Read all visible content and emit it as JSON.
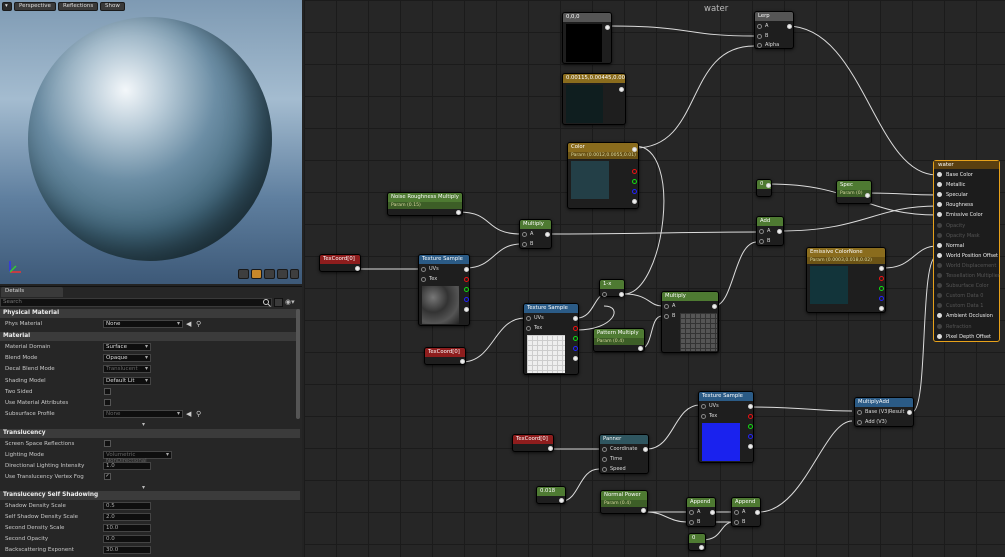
{
  "viewport": {
    "mode_label": "Perspective",
    "view_label": "Reflections",
    "show_label": "Show"
  },
  "details": {
    "tab": "Details",
    "search_placeholder": "Search"
  },
  "sections": {
    "physical": {
      "title": "Physical Material",
      "phys_label": "Phys Material",
      "phys_value": "None"
    },
    "material": {
      "title": "Material",
      "domain_label": "Material Domain",
      "domain_value": "Surface",
      "blend_label": "Blend Mode",
      "blend_value": "Opaque",
      "decal_label": "Decal Blend Mode",
      "decal_value": "Translucent",
      "shading_label": "Shading Model",
      "shading_value": "Default Lit",
      "two_sided_label": "Two Sided",
      "attrs_label": "Use Material Attributes",
      "subsurface_label": "Subsurface Profile",
      "subsurface_value": "None"
    },
    "translucency": {
      "title": "Translucency",
      "ssr_label": "Screen Space Reflections",
      "lighting_label": "Lighting Mode",
      "lighting_value": "Volumetric NonDirectional",
      "dir_label": "Directional Lighting Intensity",
      "dir_value": "1.0",
      "fog_label": "Use Translucency Vertex Fog"
    },
    "selfshadow": {
      "title": "Translucency Self Shadowing",
      "sds_label": "Shadow Density Scale",
      "sds_value": "0.5",
      "ssds_label": "Self Shadow Density Scale",
      "ssds_value": "2.0",
      "sec_label": "Second Density Scale",
      "sec_value": "10.0",
      "opac_label": "Second Opacity",
      "opac_value": "0.0",
      "back_label": "Backscattering Exponent",
      "back_value": "30.0"
    }
  },
  "graph": {
    "title": "water",
    "nodes": {
      "const000": "0,0,0",
      "constvec": "0.00115,0.00445,0.005",
      "lerp": "Lerp",
      "lerp_a": "A",
      "lerp_b": "B",
      "lerp_alpha": "Alpha",
      "color": "Color",
      "color_param": "Param (0.0012,0.0055,0.01)",
      "noise": "Noise Roughness Multiply",
      "noise_param": "Param (0.15)",
      "mult1": "Multiply",
      "a": "A",
      "b": "B",
      "texcoord1": "TexCoord[0]",
      "texsample1": "Texture Sample",
      "uvs": "UVs",
      "tex": "Tex",
      "zero1": "0",
      "spec": "Spec",
      "spec_param": "Param (0)",
      "add": "Add",
      "emissive": "Emissive ColorNone",
      "emissive_param": "Param (0.0003,0.018,0.02)",
      "onex": "1-x",
      "texsample2": "Texture Sample",
      "mult2": "Multiply",
      "pattern": "Pattern Multiply",
      "pattern_param": "Param (0.4)",
      "texcoord2": "TexCoord[0]",
      "texsample3": "Texture Sample",
      "multadd": "MultiplyAdd",
      "base_v3": "Base (V3)",
      "add_v3": "Add (V3)",
      "result": "Result",
      "texcoord3": "TexCoord[0]",
      "panner": "Panner",
      "coordinate": "Coordinate",
      "time": "Time",
      "speed": "Speed",
      "const018": "0.018",
      "normalpower": "Normal Power",
      "normalpower_param": "Param (0.4)",
      "append1": "Append",
      "append2": "Append",
      "zero2": "0"
    },
    "result_node": {
      "title": "water",
      "pins": [
        "Base Color",
        "Metallic",
        "Specular",
        "Roughness",
        "Emissive Color",
        "Opacity",
        "Opacity Mask",
        "Normal",
        "World Position Offset",
        "World Displacement",
        "Tessellation Multiplier",
        "Subsurface Color",
        "Custom Data 0",
        "Custom Data 1",
        "Ambient Occlusion",
        "Refraction",
        "Pixel Depth Offset"
      ],
      "inactive": [
        5,
        6,
        9,
        10,
        11,
        12,
        13,
        15
      ]
    }
  }
}
